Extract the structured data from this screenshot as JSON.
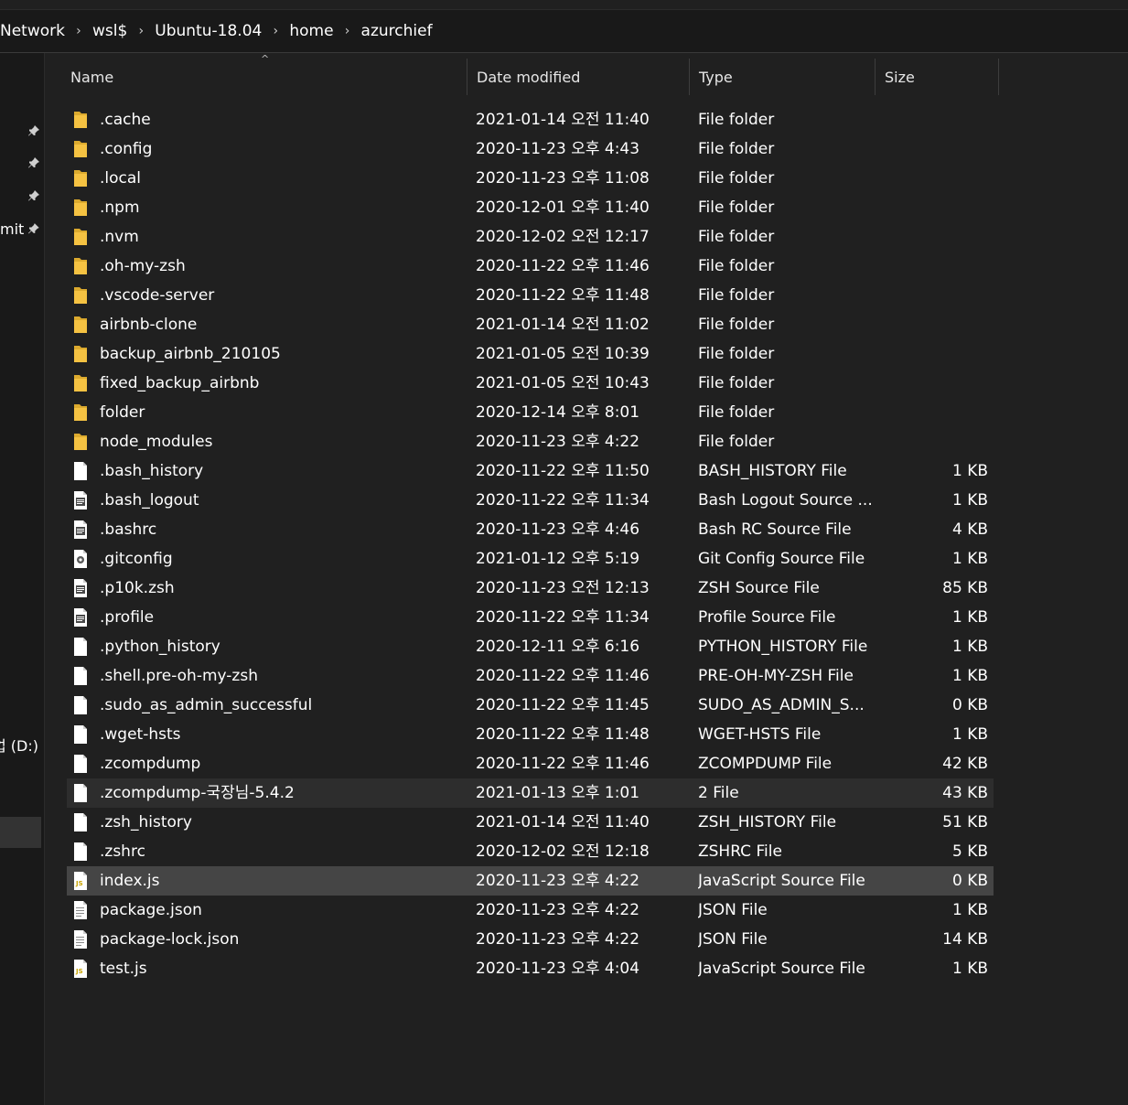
{
  "breadcrumb": [
    "Network",
    "wsl$",
    "Ubuntu-18.04",
    "home",
    "azurchief"
  ],
  "nav": {
    "items": [
      {
        "label": "",
        "pinned": true
      },
      {
        "label": "",
        "pinned": true
      },
      {
        "label": "",
        "pinned": true
      },
      {
        "label": "mit",
        "pinned": true
      },
      {
        "label": "업 (D:)",
        "pinned": false
      }
    ]
  },
  "columns": {
    "name": "Name",
    "date": "Date modified",
    "type": "Type",
    "size": "Size",
    "sort_indicator": "^"
  },
  "files": [
    {
      "name": ".cache",
      "date": "2021-01-14 오전 11:40",
      "type": "File folder",
      "size": "",
      "icon": "folder"
    },
    {
      "name": ".config",
      "date": "2020-11-23 오후 4:43",
      "type": "File folder",
      "size": "",
      "icon": "folder"
    },
    {
      "name": ".local",
      "date": "2020-11-23 오후 11:08",
      "type": "File folder",
      "size": "",
      "icon": "folder"
    },
    {
      "name": ".npm",
      "date": "2020-12-01 오후 11:40",
      "type": "File folder",
      "size": "",
      "icon": "folder"
    },
    {
      "name": ".nvm",
      "date": "2020-12-02 오전 12:17",
      "type": "File folder",
      "size": "",
      "icon": "folder"
    },
    {
      "name": ".oh-my-zsh",
      "date": "2020-11-22 오후 11:46",
      "type": "File folder",
      "size": "",
      "icon": "folder"
    },
    {
      "name": ".vscode-server",
      "date": "2020-11-22 오후 11:48",
      "type": "File folder",
      "size": "",
      "icon": "folder"
    },
    {
      "name": "airbnb-clone",
      "date": "2021-01-14 오전 11:02",
      "type": "File folder",
      "size": "",
      "icon": "folder"
    },
    {
      "name": "backup_airbnb_210105",
      "date": "2021-01-05 오전 10:39",
      "type": "File folder",
      "size": "",
      "icon": "folder"
    },
    {
      "name": "fixed_backup_airbnb",
      "date": "2021-01-05 오전 10:43",
      "type": "File folder",
      "size": "",
      "icon": "folder"
    },
    {
      "name": "folder",
      "date": "2020-12-14 오후 8:01",
      "type": "File folder",
      "size": "",
      "icon": "folder"
    },
    {
      "name": "node_modules",
      "date": "2020-11-23 오후 4:22",
      "type": "File folder",
      "size": "",
      "icon": "folder"
    },
    {
      "name": ".bash_history",
      "date": "2020-11-22 오후 11:50",
      "type": "BASH_HISTORY File",
      "size": "1 KB",
      "icon": "blank"
    },
    {
      "name": ".bash_logout",
      "date": "2020-11-22 오후 11:34",
      "type": "Bash Logout Source ...",
      "size": "1 KB",
      "icon": "source"
    },
    {
      "name": ".bashrc",
      "date": "2020-11-23 오후 4:46",
      "type": "Bash RC Source File",
      "size": "4 KB",
      "icon": "source"
    },
    {
      "name": ".gitconfig",
      "date": "2021-01-12 오후 5:19",
      "type": "Git Config Source File",
      "size": "1 KB",
      "icon": "config"
    },
    {
      "name": ".p10k.zsh",
      "date": "2020-11-23 오전 12:13",
      "type": "ZSH Source File",
      "size": "85 KB",
      "icon": "source"
    },
    {
      "name": ".profile",
      "date": "2020-11-22 오후 11:34",
      "type": "Profile Source File",
      "size": "1 KB",
      "icon": "source"
    },
    {
      "name": ".python_history",
      "date": "2020-12-11 오후 6:16",
      "type": "PYTHON_HISTORY File",
      "size": "1 KB",
      "icon": "blank"
    },
    {
      "name": ".shell.pre-oh-my-zsh",
      "date": "2020-11-22 오후 11:46",
      "type": "PRE-OH-MY-ZSH File",
      "size": "1 KB",
      "icon": "blank"
    },
    {
      "name": ".sudo_as_admin_successful",
      "date": "2020-11-22 오후 11:45",
      "type": "SUDO_AS_ADMIN_S...",
      "size": "0 KB",
      "icon": "blank"
    },
    {
      "name": ".wget-hsts",
      "date": "2020-11-22 오후 11:48",
      "type": "WGET-HSTS File",
      "size": "1 KB",
      "icon": "blank"
    },
    {
      "name": ".zcompdump",
      "date": "2020-11-22 오후 11:46",
      "type": "ZCOMPDUMP File",
      "size": "42 KB",
      "icon": "blank"
    },
    {
      "name": ".zcompdump-국장님-5.4.2",
      "date": "2021-01-13 오후 1:01",
      "type": "2 File",
      "size": "43 KB",
      "icon": "blank",
      "state": "hover"
    },
    {
      "name": ".zsh_history",
      "date": "2021-01-14 오전 11:40",
      "type": "ZSH_HISTORY File",
      "size": "51 KB",
      "icon": "blank"
    },
    {
      "name": ".zshrc",
      "date": "2020-12-02 오전 12:18",
      "type": "ZSHRC File",
      "size": "5 KB",
      "icon": "blank"
    },
    {
      "name": "index.js",
      "date": "2020-11-23 오후 4:22",
      "type": "JavaScript Source File",
      "size": "0 KB",
      "icon": "js",
      "state": "selected"
    },
    {
      "name": "package.json",
      "date": "2020-11-23 오후 4:22",
      "type": "JSON File",
      "size": "1 KB",
      "icon": "text"
    },
    {
      "name": "package-lock.json",
      "date": "2020-11-23 오후 4:22",
      "type": "JSON File",
      "size": "14 KB",
      "icon": "text"
    },
    {
      "name": "test.js",
      "date": "2020-11-23 오후 4:04",
      "type": "JavaScript Source File",
      "size": "1 KB",
      "icon": "js"
    }
  ],
  "colors": {
    "background": "#202020",
    "nav_background": "#191919",
    "folder": "#f5c242",
    "selected_row": "#454545",
    "hover_row": "#2d2d2d",
    "text": "#ffffff"
  }
}
